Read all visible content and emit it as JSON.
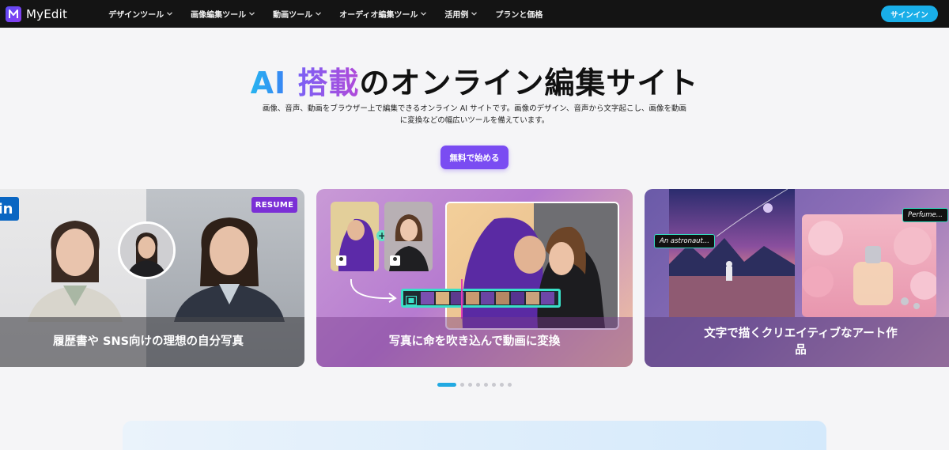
{
  "nav": {
    "logo_text": "MyEdit",
    "items": [
      {
        "label": "デザインツール",
        "icon": "chevron-down-icon"
      },
      {
        "label": "画像編集ツール",
        "icon": "chevron-down-icon"
      },
      {
        "label": "動画ツール",
        "icon": "chevron-down-icon"
      },
      {
        "label": "オーディオ編集ツール",
        "icon": "chevron-down-icon"
      },
      {
        "label": "活用例",
        "icon": "chevron-down-icon"
      },
      {
        "label": "プランと価格"
      }
    ],
    "signin_label": "サインイン"
  },
  "hero": {
    "title_ai": "AI",
    "title_tousai": "搭載",
    "title_rest": "のオンライン編集サイト",
    "description": "画像、音声、動画をブラウザー上で編集できるオンライン AI サイトです。画像のデザイン、音声から文字起こし、画像を動画に変換などの幅広いツールを備えています。",
    "cta_label": "無料で始める"
  },
  "carousel": {
    "cards": [
      {
        "caption": "履歴書や SNS向けの理想の自分写真",
        "badge": "RESUME",
        "logo_text": "in"
      },
      {
        "caption": "写真に命を吹き込んで動画に変換"
      },
      {
        "caption": "文字で描くクリエイティブなアート作品",
        "tag1": "An astronaut...",
        "tag2": "Perfume..."
      }
    ],
    "dots_count": 8,
    "active_dot": 0
  },
  "colors": {
    "nav_bg": "#141414",
    "signin": "#19aee8",
    "cta": "#7a4cf2",
    "dot_active": "#22a9e2"
  }
}
